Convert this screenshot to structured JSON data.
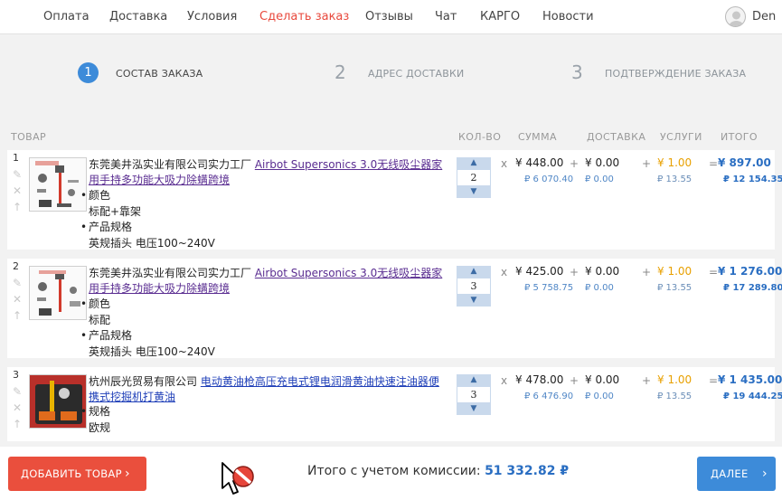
{
  "nav": {
    "items": [
      "Оплата",
      "Доставка",
      "Условия",
      "Сделать заказ",
      "Отзывы",
      "Чат",
      "КАРГО",
      "Новости"
    ],
    "user": "Den"
  },
  "steps": [
    {
      "num": "1",
      "label": "СОСТАВ ЗАКАЗА"
    },
    {
      "num": "2",
      "label": "АДРЕС ДОСТАВКИ"
    },
    {
      "num": "3",
      "label": "ПОДТВЕРЖДЕНИЕ ЗАКАЗА"
    }
  ],
  "headers": {
    "product": "ТОВАР",
    "qty": "КОЛ-ВО",
    "sum": "СУММА",
    "delivery": "ДОСТАВКА",
    "services": "УСЛУГИ",
    "total": "ИТОГО"
  },
  "items": [
    {
      "num": "1",
      "seller": "东莞美井泓实业有限公司实力工厂 ",
      "link": "Airbot Supersonics 3.0无线吸尘器家用手持多功能大吸力除螨跨境",
      "opts": [
        "颜色",
        "标配+靠架",
        "产品规格",
        "英规插头 电压100~240V"
      ],
      "qty": "2",
      "sum": "¥ 448.00",
      "sum_rub": "₽ 6 070.40",
      "delivery": "¥ 0.00",
      "delivery_rub": "₽ 0.00",
      "services": "¥ 1.00",
      "services_rub": "₽ 13.55",
      "total": "¥ 897.00",
      "total_rub": "₽ 12 154.35"
    },
    {
      "num": "2",
      "seller": "东莞美井泓实业有限公司实力工厂 ",
      "link": "Airbot Supersonics 3.0无线吸尘器家用手持多功能大吸力除螨跨境",
      "opts": [
        "颜色",
        "标配",
        "产品规格",
        "英规插头 电压100~240V"
      ],
      "qty": "3",
      "sum": "¥ 425.00",
      "sum_rub": "₽ 5 758.75",
      "delivery": "¥ 0.00",
      "delivery_rub": "₽ 0.00",
      "services": "¥ 1.00",
      "services_rub": "₽ 13.55",
      "total": "¥ 1 276.00",
      "total_rub": "₽ 17 289.80"
    },
    {
      "num": "3",
      "seller": "杭州辰光贸易有限公司 ",
      "link": "电动黄油枪高压充电式锂电润滑黄油快速注油器便携式挖掘机打黄油",
      "opts": [
        "规格",
        "欧规"
      ],
      "qty": "3",
      "sum": "¥ 478.00",
      "sum_rub": "₽ 6 476.90",
      "delivery": "¥ 0.00",
      "delivery_rub": "₽ 0.00",
      "services": "¥ 1.00",
      "services_rub": "₽ 13.55",
      "total": "¥ 1 435.00",
      "total_rub": "₽ 19 444.25"
    }
  ],
  "ops": {
    "mul": "x",
    "plus": "+",
    "eq": "="
  },
  "footer": {
    "add_label": "ДОБАВИТЬ ТОВАР",
    "sum_label": "Итого с учетом комиссии: ",
    "sum_value": "51 332.82 ₽",
    "next_label": "ДАЛЕЕ"
  },
  "colors": {
    "accent": "#3d8bd9",
    "danger": "#ea4f3d",
    "active_nav": "#e8493d",
    "services": "#e8a000"
  }
}
